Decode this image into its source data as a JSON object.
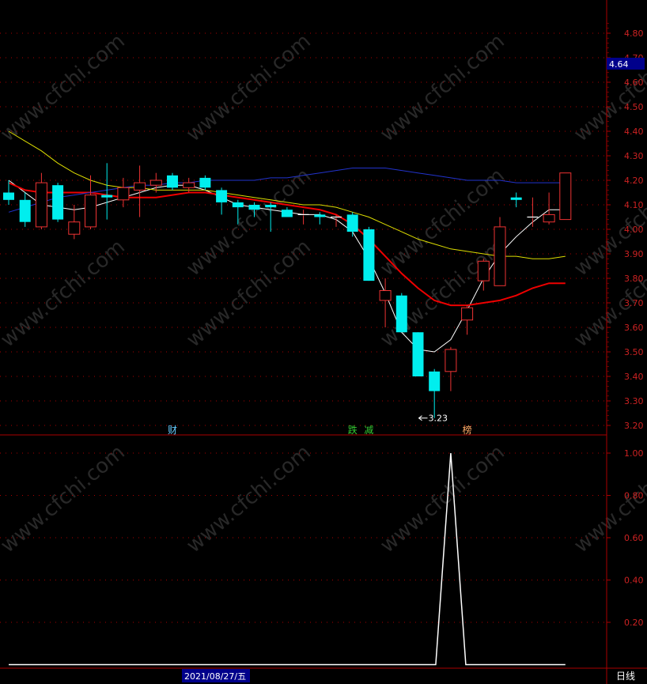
{
  "chart_data": [
    {
      "type": "candlestick",
      "ylim": [
        3.17,
        4.9
      ],
      "y_ticks": [
        "4.80",
        "4.70",
        "4.60",
        "4.50",
        "4.40",
        "4.30",
        "4.20",
        "4.10",
        "4.00",
        "3.90",
        "3.80",
        "3.70",
        "3.60",
        "3.50",
        "3.40",
        "3.30",
        "3.20"
      ],
      "last_price": "4.64",
      "low_annotation": {
        "text": "3.23",
        "index": 25,
        "value": 3.23
      },
      "signals": [
        {
          "text": "财",
          "index": 10,
          "color": "#66ccff"
        },
        {
          "text": "跌",
          "index": 21,
          "color": "#33cc33"
        },
        {
          "text": "减",
          "index": 22,
          "color": "#33cc33"
        },
        {
          "text": "榜",
          "index": 28,
          "color": "#ffaa66"
        }
      ],
      "candles": [
        {
          "o": 4.15,
          "h": 4.2,
          "l": 4.1,
          "c": 4.12
        },
        {
          "o": 4.12,
          "h": 4.15,
          "l": 4.01,
          "c": 4.03
        },
        {
          "o": 4.01,
          "h": 4.23,
          "l": 4.0,
          "c": 4.19
        },
        {
          "o": 4.18,
          "h": 4.19,
          "l": 4.03,
          "c": 4.04
        },
        {
          "o": 3.98,
          "h": 4.1,
          "l": 3.96,
          "c": 4.03
        },
        {
          "o": 4.01,
          "h": 4.22,
          "l": 4.0,
          "c": 4.14
        },
        {
          "o": 4.14,
          "h": 4.27,
          "l": 4.04,
          "c": 4.13
        },
        {
          "o": 4.12,
          "h": 4.21,
          "l": 4.09,
          "c": 4.17
        },
        {
          "o": 4.16,
          "h": 4.26,
          "l": 4.05,
          "c": 4.19
        },
        {
          "o": 4.18,
          "h": 4.23,
          "l": 4.15,
          "c": 4.2
        },
        {
          "o": 4.22,
          "h": 4.23,
          "l": 4.16,
          "c": 4.17
        },
        {
          "o": 4.17,
          "h": 4.21,
          "l": 4.15,
          "c": 4.19
        },
        {
          "o": 4.21,
          "h": 4.22,
          "l": 4.16,
          "c": 4.17
        },
        {
          "o": 4.16,
          "h": 4.17,
          "l": 4.06,
          "c": 4.11
        },
        {
          "o": 4.11,
          "h": 4.12,
          "l": 4.02,
          "c": 4.09
        },
        {
          "o": 4.1,
          "h": 4.11,
          "l": 4.05,
          "c": 4.08
        },
        {
          "o": 4.1,
          "h": 4.11,
          "l": 3.99,
          "c": 4.09
        },
        {
          "o": 4.08,
          "h": 4.09,
          "l": 4.05,
          "c": 4.05
        },
        {
          "o": 4.06,
          "h": 4.08,
          "l": 4.02,
          "c": 4.06
        },
        {
          "o": 4.06,
          "h": 4.07,
          "l": 4.02,
          "c": 4.05
        },
        {
          "o": 4.05,
          "h": 4.06,
          "l": 4.01,
          "c": 4.05
        },
        {
          "o": 4.06,
          "h": 4.07,
          "l": 3.97,
          "c": 3.99
        },
        {
          "o": 4.0,
          "h": 4.01,
          "l": 3.79,
          "c": 3.79
        },
        {
          "o": 3.71,
          "h": 3.8,
          "l": 3.6,
          "c": 3.75
        },
        {
          "o": 3.73,
          "h": 3.74,
          "l": 3.58,
          "c": 3.58
        },
        {
          "o": 3.58,
          "h": 3.58,
          "l": 3.4,
          "c": 3.4
        },
        {
          "o": 3.42,
          "h": 3.43,
          "l": 3.23,
          "c": 3.34
        },
        {
          "o": 3.42,
          "h": 3.52,
          "l": 3.34,
          "c": 3.51
        },
        {
          "o": 3.63,
          "h": 3.69,
          "l": 3.57,
          "c": 3.68
        },
        {
          "o": 3.79,
          "h": 3.88,
          "l": 3.75,
          "c": 3.87
        },
        {
          "o": 3.77,
          "h": 4.05,
          "l": 3.77,
          "c": 4.01
        },
        {
          "o": 4.13,
          "h": 4.15,
          "l": 4.09,
          "c": 4.12
        },
        {
          "o": 4.05,
          "h": 4.13,
          "l": 4.01,
          "c": 4.05
        },
        {
          "o": 4.03,
          "h": 4.15,
          "l": 4.02,
          "c": 4.06
        },
        {
          "o": 4.04,
          "h": 4.23,
          "l": 4.04,
          "c": 4.23
        }
      ],
      "series": [
        {
          "color": "#ffffff",
          "values": [
            4.2,
            4.15,
            4.1,
            4.09,
            4.08,
            4.09,
            4.11,
            4.13,
            4.15,
            4.17,
            4.18,
            4.18,
            4.16,
            4.13,
            4.1,
            4.09,
            4.08,
            4.07,
            4.06,
            4.06,
            4.04,
            3.99,
            3.88,
            3.74,
            3.58,
            3.51,
            3.5,
            3.55,
            3.67,
            3.8,
            3.9,
            3.97,
            4.03,
            4.08,
            4.08
          ]
        },
        {
          "color": "#ee0000",
          "values": [
            4.19,
            4.16,
            4.15,
            4.15,
            4.15,
            4.15,
            4.14,
            4.13,
            4.13,
            4.13,
            4.14,
            4.15,
            4.15,
            4.14,
            4.13,
            4.12,
            4.11,
            4.1,
            4.09,
            4.08,
            4.06,
            4.02,
            3.96,
            3.89,
            3.82,
            3.76,
            3.71,
            3.69,
            3.69,
            3.7,
            3.71,
            3.73,
            3.76,
            3.78,
            3.78
          ]
        },
        {
          "color": "#dddd00",
          "values": [
            4.4,
            4.36,
            4.32,
            4.27,
            4.23,
            4.2,
            4.18,
            4.17,
            4.17,
            4.16,
            4.16,
            4.16,
            4.16,
            4.15,
            4.14,
            4.13,
            4.12,
            4.11,
            4.1,
            4.1,
            4.09,
            4.07,
            4.05,
            4.02,
            3.99,
            3.96,
            3.94,
            3.92,
            3.91,
            3.9,
            3.89,
            3.89,
            3.88,
            3.88,
            3.89
          ]
        },
        {
          "color": "#2233cc",
          "values": [
            4.07,
            4.09,
            4.11,
            4.13,
            4.14,
            4.15,
            4.16,
            4.17,
            4.18,
            4.18,
            4.19,
            4.19,
            4.2,
            4.2,
            4.2,
            4.2,
            4.21,
            4.21,
            4.22,
            4.23,
            4.24,
            4.25,
            4.25,
            4.25,
            4.24,
            4.23,
            4.22,
            4.21,
            4.2,
            4.2,
            4.2,
            4.19,
            4.19,
            4.19,
            4.19
          ]
        }
      ]
    },
    {
      "type": "line",
      "ylim": [
        0,
        1.07
      ],
      "y_ticks": [
        "1.00",
        "0.80",
        "0.60",
        "0.40",
        "0.20"
      ],
      "series": [
        {
          "color": "#ffffff",
          "values": [
            0,
            0,
            0,
            0,
            0,
            0,
            0,
            0,
            0,
            0,
            0,
            0,
            0,
            0,
            0,
            0,
            0,
            0,
            0,
            0,
            0,
            0,
            0,
            0,
            0,
            0,
            0,
            1,
            0,
            0,
            0,
            0,
            0,
            0,
            0
          ]
        }
      ]
    }
  ],
  "footer": {
    "date_label": "2021/08/27/五",
    "period_label": "日线"
  },
  "watermark": "www.cfchi.com"
}
